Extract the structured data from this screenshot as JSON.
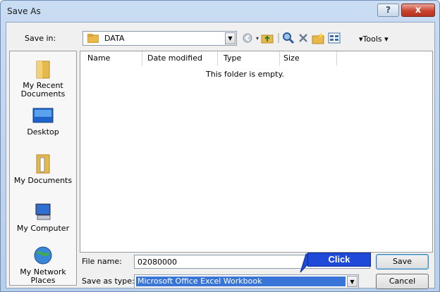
{
  "window": {
    "title": "Save As",
    "help_glyph": "?",
    "close_glyph": "x"
  },
  "toolbar": {
    "save_in_label": "Save in:",
    "save_in_value": "DATA",
    "tools_label": "▾Tools ▾",
    "icons": [
      "back-icon",
      "up-folder-icon",
      "search-web-icon",
      "delete-icon",
      "new-folder-icon",
      "views-icon"
    ]
  },
  "places": [
    {
      "label": "My Recent Documents",
      "icon": "recent-documents-icon"
    },
    {
      "label": "Desktop",
      "icon": "desktop-icon"
    },
    {
      "label": "My Documents",
      "icon": "my-documents-icon"
    },
    {
      "label": "My Computer",
      "icon": "my-computer-icon"
    },
    {
      "label": "My Network Places",
      "icon": "network-places-icon"
    }
  ],
  "filelist": {
    "columns": [
      "Name",
      "Date modified",
      "Type",
      "Size"
    ],
    "empty_message": "This folder is empty."
  },
  "form": {
    "file_name_label": "File name:",
    "file_name_value": "02080000",
    "save_as_type_label": "Save as type:",
    "save_as_type_value": "Microsoft Office Excel Workbook"
  },
  "buttons": {
    "save": "Save",
    "cancel": "Cancel"
  },
  "annotation": {
    "callout_text": "Click"
  },
  "colors": {
    "selection": "#3875d7",
    "callout": "#1f4ad8"
  }
}
